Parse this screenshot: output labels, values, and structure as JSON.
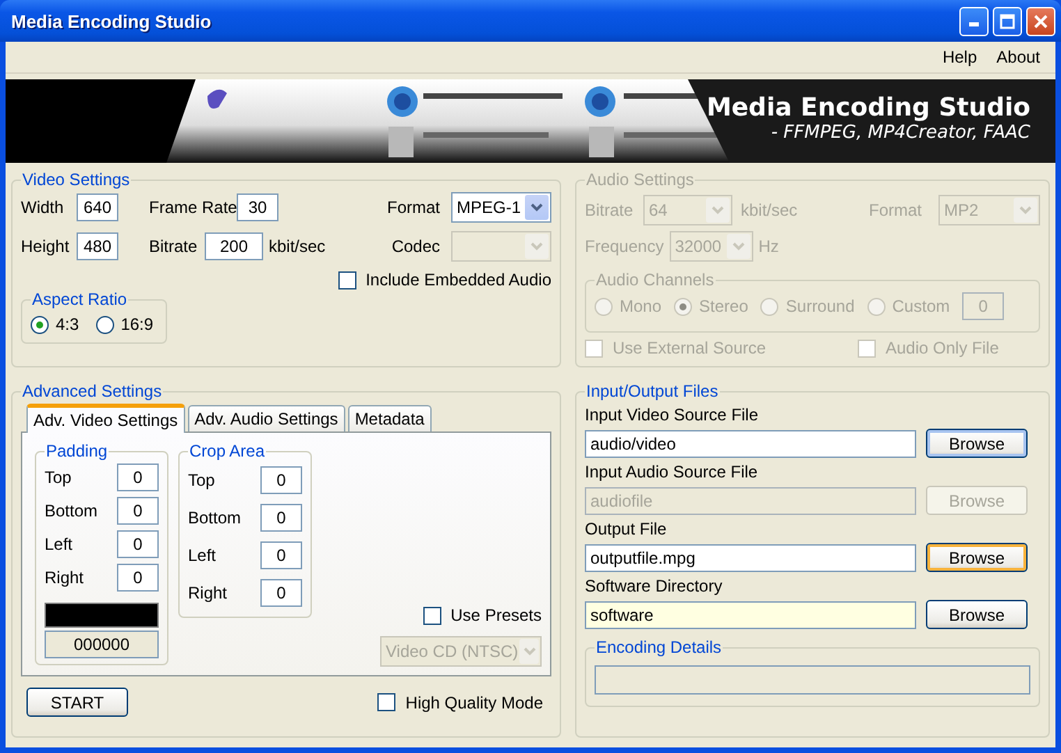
{
  "window": {
    "title": "Media Encoding Studio"
  },
  "menu": [
    {
      "label": "Help"
    },
    {
      "label": "About"
    }
  ],
  "banner": {
    "title": "Media Encoding Studio",
    "subtitle": "- FFMPEG, MP4Creator, FAAC"
  },
  "video_settings": {
    "title": "Video Settings",
    "disabled": false,
    "width": {
      "label": "Width",
      "value": "640"
    },
    "height": {
      "label": "Height",
      "value": "480"
    },
    "frame_rate": {
      "label": "Frame Rate",
      "value": "30"
    },
    "bitrate": {
      "label": "Bitrate",
      "value": "200",
      "unit": "kbit/sec"
    },
    "format": {
      "label": "Format",
      "value": "MPEG-1",
      "disabled": false
    },
    "codec": {
      "label": "Codec",
      "disabled": true
    },
    "include_embedded_audio": {
      "label": "Include Embedded Audio",
      "checked": false
    },
    "aspect_ratio": {
      "title": "Aspect Ratio",
      "options": [
        {
          "label": "4:3",
          "selected": true
        },
        {
          "label": "16:9",
          "selected": false
        }
      ]
    }
  },
  "audio_settings": {
    "title": "Audio Settings",
    "disabled": true,
    "bitrate": {
      "label": "Bitrate",
      "value": "64",
      "unit": "kbit/sec"
    },
    "format": {
      "label": "Format",
      "value": "MP2"
    },
    "frequency": {
      "label": "Frequency",
      "value": "32000",
      "unit": "Hz"
    },
    "audio_channels": {
      "title": "Audio Channels",
      "options": [
        {
          "label": "Mono",
          "selected": false
        },
        {
          "label": "Stereo",
          "selected": true
        },
        {
          "label": "Surround",
          "selected": false
        },
        {
          "label": "Custom",
          "selected": false
        }
      ],
      "custom_value": "0"
    },
    "use_external_source": {
      "label": "Use External Source",
      "checked": false
    },
    "audio_only_file": {
      "label": "Audio Only File",
      "checked": false
    }
  },
  "advanced_settings": {
    "title": "Advanced Settings",
    "tabs": [
      {
        "label": "Adv. Video Settings",
        "selected": true
      },
      {
        "label": "Adv. Audio Settings",
        "selected": false
      },
      {
        "label": "Metadata",
        "selected": false
      }
    ],
    "padding": {
      "title": "Padding",
      "fields": [
        {
          "label": "Top",
          "value": "0"
        },
        {
          "label": "Bottom",
          "value": "0"
        },
        {
          "label": "Left",
          "value": "0"
        },
        {
          "label": "Right",
          "value": "0"
        }
      ],
      "color_code": "000000"
    },
    "crop_area": {
      "title": "Crop Area",
      "fields": [
        {
          "label": "Top",
          "value": "0"
        },
        {
          "label": "Bottom",
          "value": "0"
        },
        {
          "label": "Left",
          "value": "0"
        },
        {
          "label": "Right",
          "value": "0"
        }
      ]
    },
    "use_presets": {
      "label": "Use Presets",
      "checked": false
    },
    "preset": {
      "value": "Video CD (NTSC)",
      "disabled": true
    },
    "start_button": {
      "label": "START"
    },
    "high_quality_mode": {
      "label": "High Quality Mode",
      "checked": false
    }
  },
  "io_files": {
    "title": "Input/Output Files",
    "files": [
      {
        "label": "Input Video Source File",
        "value": "audio/video",
        "disabled": false,
        "focused": false,
        "button": {
          "label": "Browse",
          "default": true,
          "hover": false
        }
      },
      {
        "label": "Input Audio Source File",
        "value": "audiofile",
        "disabled": true,
        "focused": false,
        "button": {
          "label": "Browse",
          "default": false,
          "hover": false
        }
      },
      {
        "label": "Output File",
        "value": "outputfile.mpg",
        "disabled": false,
        "focused": false,
        "button": {
          "label": "Browse",
          "default": false,
          "hover": true
        }
      },
      {
        "label": "Software Directory",
        "value": "software",
        "disabled": false,
        "focused": true,
        "button": {
          "label": "Browse",
          "default": false,
          "hover": false
        }
      }
    ],
    "encoding_details": {
      "title": "Encoding Details"
    }
  }
}
